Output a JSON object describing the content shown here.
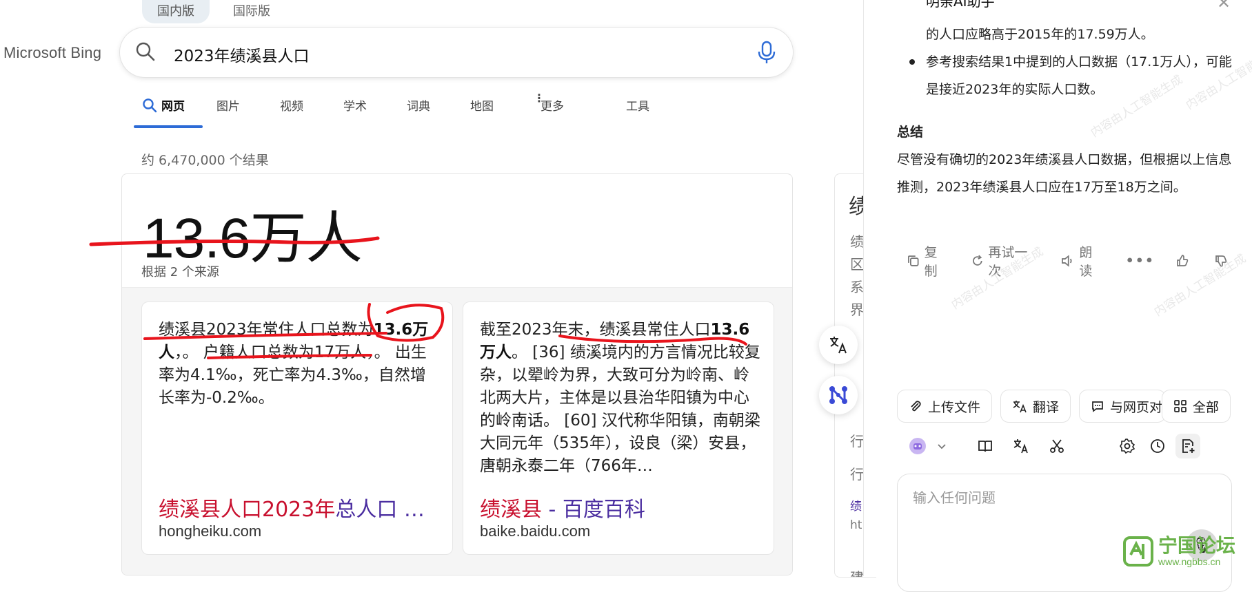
{
  "region_tabs": [
    "国内版",
    "国际版"
  ],
  "brand": "Microsoft Bing",
  "search": {
    "query": "2023年绩溪县人口",
    "icon": "search-icon",
    "mic_icon": "microphone-icon"
  },
  "nav_tabs": [
    "网页",
    "图片",
    "视频",
    "学术",
    "词典",
    "地图",
    "更多",
    "工具"
  ],
  "result_count": "约 6,470,000 个结果",
  "answer": {
    "value": "13.6万人",
    "sources_note": "根据 2 个来源",
    "sources": [
      {
        "snippet_pre": "绩溪县2023年常住人口总数为",
        "snippet_bold": "13.6万人",
        "snippet_post": "，。 户籍人口总数为17万人，。 出生率为4.1‰，死亡率为4.3‰，自然增长率为-0.2‰。",
        "title_a": "绩溪县人口2023年",
        "title_b": "总人口 …",
        "domain": "hongheiku.com"
      },
      {
        "snippet_pre": "截至2023年末，绩溪县常住人口",
        "snippet_bold": "13.6万人",
        "snippet_post": "。 [36] 绩溪境内的方言情况比较复杂，以翚岭为界，大致可分为岭南、岭北两大片，主体是以县治华阳镇为中心的岭南话。 [60] 汉代称华阳镇，南朝梁大同元年（535年），设良（梁）安县，唐朝永泰二年（766年…",
        "title_a": "绩溪县",
        "title_b": " - 百度百科",
        "domain": "baike.baidu.com"
      }
    ]
  },
  "side_column_chars": [
    "绩",
    "绩",
    "区",
    "系",
    "界",
    "行",
    "行",
    "绩",
    "ht",
    "建"
  ],
  "assistant": {
    "header": "明亲AI助手",
    "messages": {
      "line1": "的人口应略高于2015年的17.59万人。",
      "bullet": "参考搜索结果1中提到的人口数据（17.1万人），可能是接近2023年的实际人口数。",
      "section_title": "总结",
      "summary": "尽管没有确切的2023年绩溪县人口数据，但根据以上信息推测，2023年绩溪县人口应在17万至18万之间。"
    },
    "actions": [
      "复制",
      "再试一次",
      "朗读"
    ],
    "chips": [
      "上传文件",
      "翻译",
      "与网页对",
      "全部"
    ],
    "input_placeholder": "输入任何问题",
    "watermark": "内容由人工智能生成"
  },
  "forum_logo": {
    "name": "宁国论坛",
    "url": "www.ngbbs.cn"
  },
  "colors": {
    "accent_blue": "#2d6bd6",
    "title_red": "#c8102e",
    "title_purple": "#4b2ea0",
    "annotation_red": "#e8141c",
    "forum_green": "#6ab24a"
  }
}
